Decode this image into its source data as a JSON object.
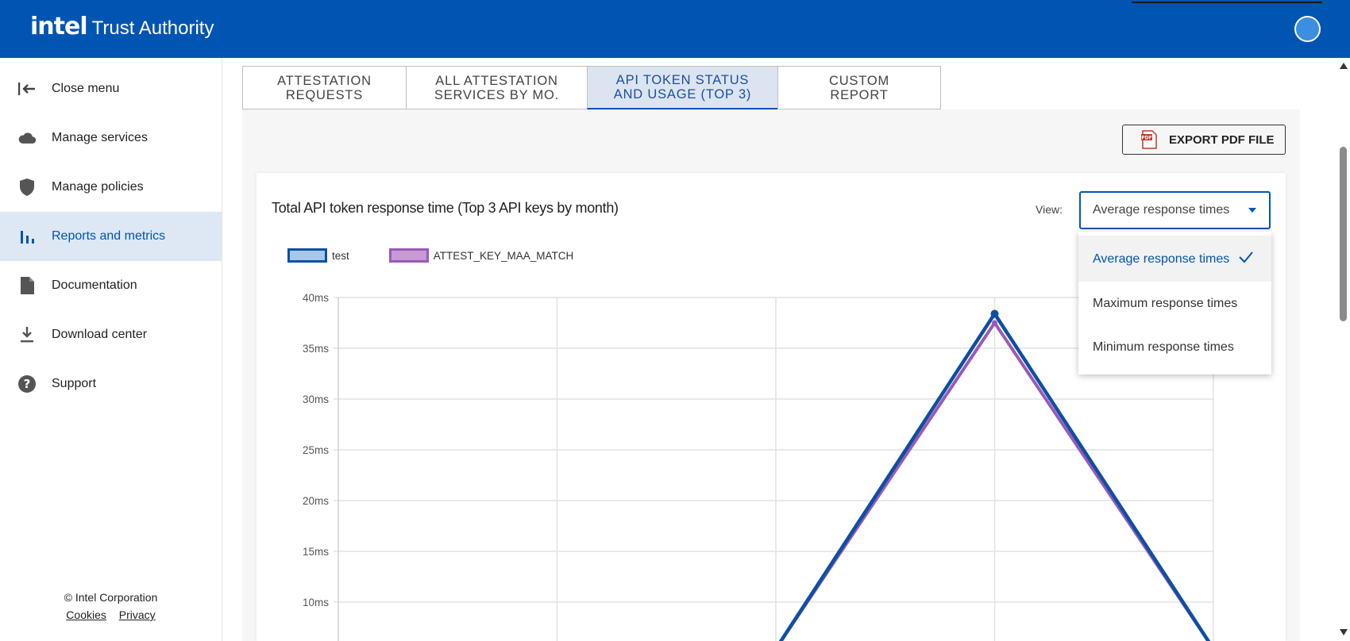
{
  "header": {
    "logo": "intel",
    "product": "Trust Authority"
  },
  "sidebar": {
    "items": [
      {
        "label": "Close menu",
        "icon": "close-menu-icon"
      },
      {
        "label": "Manage services",
        "icon": "cloud-icon"
      },
      {
        "label": "Manage policies",
        "icon": "shield-icon"
      },
      {
        "label": "Reports and metrics",
        "icon": "bar-chart-icon",
        "active": true
      },
      {
        "label": "Documentation",
        "icon": "document-icon"
      },
      {
        "label": "Download center",
        "icon": "download-icon"
      },
      {
        "label": "Support",
        "icon": "help-icon"
      }
    ],
    "footer": {
      "copyright": "© Intel Corporation",
      "cookies": "Cookies",
      "privacy": "Privacy"
    }
  },
  "tabs": [
    {
      "label": "ATTESTATION\nREQUESTS"
    },
    {
      "label": "ALL ATTESTATION\nSERVICES BY MO."
    },
    {
      "label": "API TOKEN STATUS\nAND USAGE (TOP 3)",
      "active": true
    },
    {
      "label": "CUSTOM\nREPORT"
    }
  ],
  "toolbar": {
    "export_label": "EXPORT PDF FILE",
    "pdf_icon_text": "PDF"
  },
  "card": {
    "title": "Total API token response time (Top 3 API keys by month)",
    "view_label": "View:",
    "view_selected": "Average response times",
    "view_options": [
      {
        "label": "Average response times",
        "selected": true
      },
      {
        "label": "Maximum response times"
      },
      {
        "label": "Minimum response times"
      }
    ]
  },
  "colors": {
    "brand": "#0055b3",
    "series_test": "#0d4fa3",
    "series_attest": "#9b59b6"
  },
  "chart_data": {
    "type": "line",
    "title": "Total API token response time (Top 3 API keys by month)",
    "ylim": [
      5,
      40
    ],
    "y_ticks": [
      "40ms",
      "35ms",
      "30ms",
      "25ms",
      "20ms",
      "15ms",
      "10ms"
    ],
    "x_points": 5,
    "legend": "top-left",
    "grid": true,
    "series": [
      {
        "name": "test",
        "values": [
          null,
          null,
          5.4,
          38.4,
          5.4
        ]
      },
      {
        "name": "ATTEST_KEY_MAA_MATCH",
        "values": [
          null,
          null,
          5.4,
          37.5,
          5.4
        ]
      }
    ]
  }
}
